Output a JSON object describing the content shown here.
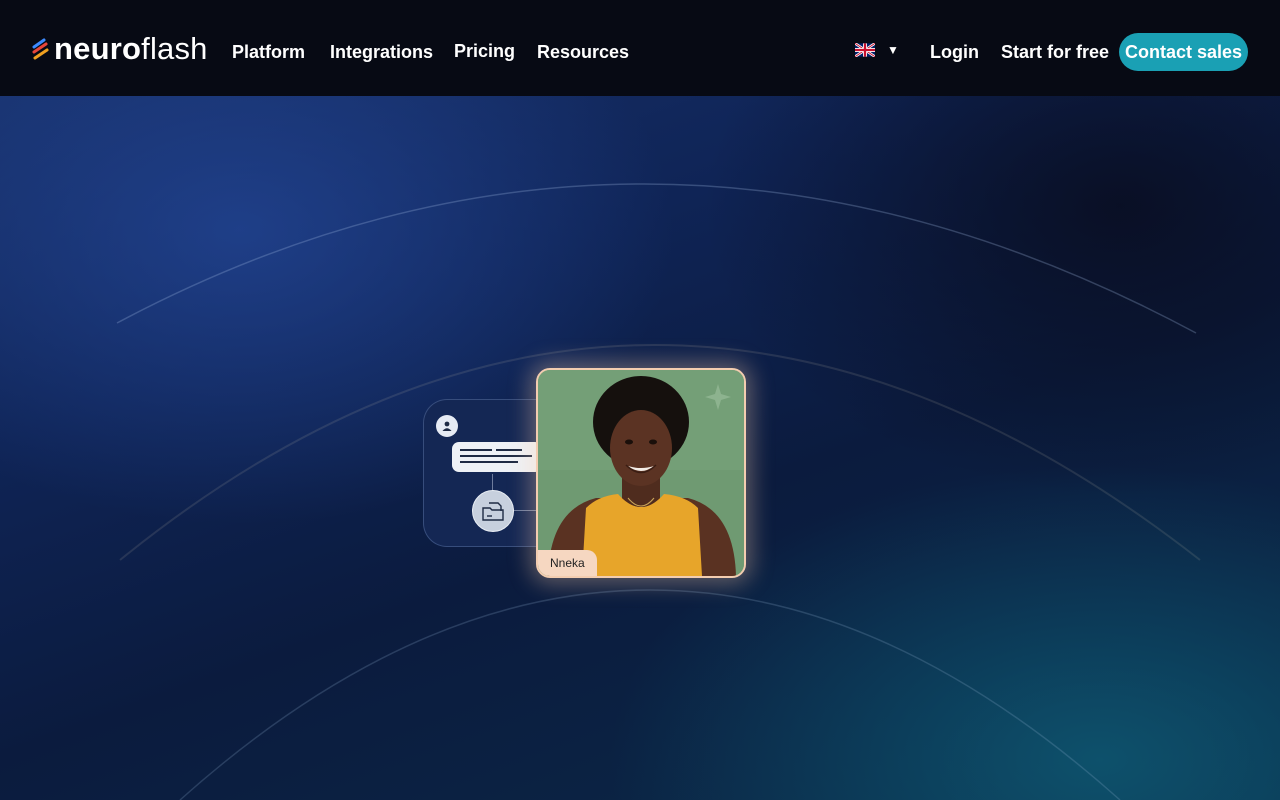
{
  "nav": {
    "logo_bold": "neuro",
    "logo_light": "flash",
    "links": [
      "Platform",
      "Integrations",
      "Pricing",
      "Resources"
    ],
    "language": {
      "icon": "uk-flag-icon",
      "caret": "▼"
    },
    "login": "Login",
    "start_free": "Start for free",
    "contact_sales": "Contact sales"
  },
  "hero": {
    "persona_name": "Nneka"
  },
  "colors": {
    "nav_bg": "#070a14",
    "accent": "#1aa0b4",
    "card_border": "#f3cdb0",
    "name_tag_bg": "#f6d7c1"
  }
}
